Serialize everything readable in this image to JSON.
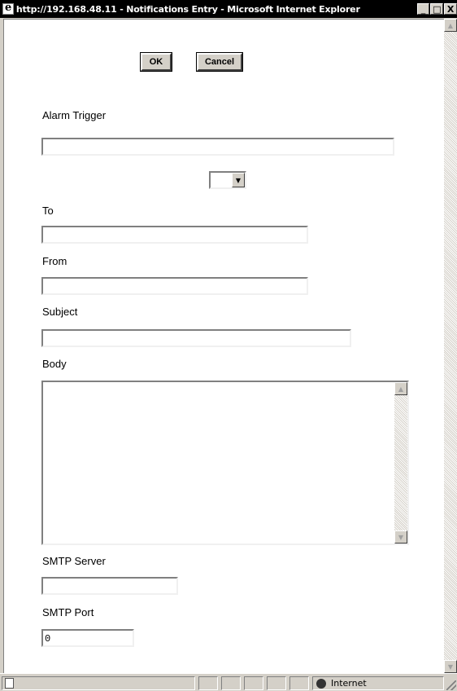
{
  "window": {
    "title": "http://192.168.48.11 - Notifications Entry - Microsoft Internet Explorer",
    "minimize": "_",
    "maximize": "□",
    "close": "X"
  },
  "buttons": {
    "ok": "OK",
    "cancel": "Cancel"
  },
  "form": {
    "alarm_trigger_label": "Alarm Trigger",
    "alarm_trigger_value": "",
    "select_value": "",
    "to_label": "To",
    "to_value": "",
    "from_label": "From",
    "from_value": "",
    "subject_label": "Subject",
    "subject_value": "",
    "body_label": "Body",
    "body_value": "",
    "smtp_server_label": "SMTP Server",
    "smtp_server_value": "",
    "smtp_port_label": "SMTP Port",
    "smtp_port_value": "0"
  },
  "status": {
    "zone": "Internet"
  },
  "icons": [
    "ie-icon",
    "minimize-icon",
    "maximize-icon",
    "close-icon",
    "scroll-up-icon",
    "scroll-down-icon",
    "dropdown-arrow-icon",
    "page-icon",
    "globe-icon",
    "resize-grip-icon"
  ]
}
